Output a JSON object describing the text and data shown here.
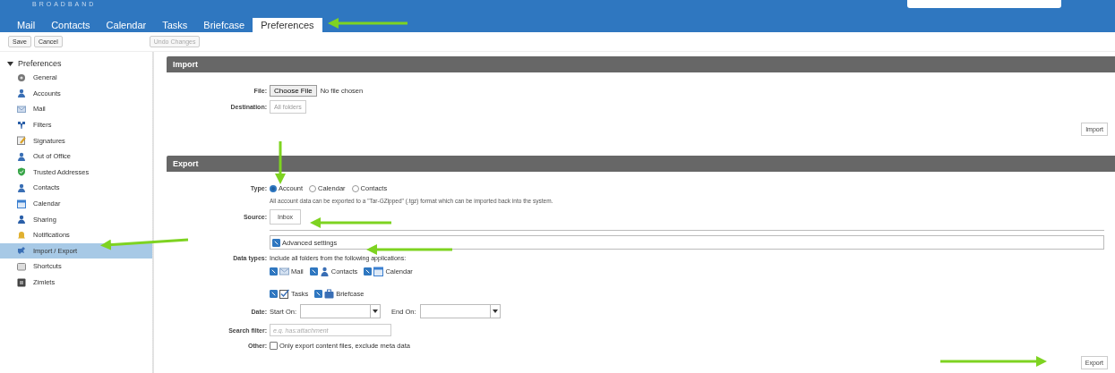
{
  "header": {
    "brand": "BROADBAND",
    "tabs": [
      {
        "label": "Mail",
        "selected": false
      },
      {
        "label": "Contacts",
        "selected": false
      },
      {
        "label": "Calendar",
        "selected": false
      },
      {
        "label": "Tasks",
        "selected": false
      },
      {
        "label": "Briefcase",
        "selected": false
      },
      {
        "label": "Preferences",
        "selected": true
      }
    ]
  },
  "toolbar": {
    "buttons": [
      {
        "label": "Save",
        "disabled": false
      },
      {
        "label": "Cancel",
        "disabled": false
      }
    ],
    "undo": {
      "label": "Undo Changes",
      "disabled": true
    }
  },
  "sidebar": {
    "label": "Preferences",
    "expanded": true,
    "children": [
      {
        "label": "General",
        "selected": false
      },
      {
        "label": "Accounts",
        "selected": false
      },
      {
        "label": "Mail",
        "selected": false
      },
      {
        "label": "Filters",
        "selected": false
      },
      {
        "label": "Signatures",
        "selected": false
      },
      {
        "label": "Out of Office",
        "selected": false
      },
      {
        "label": "Trusted Addresses",
        "selected": false
      },
      {
        "label": "Contacts",
        "selected": false
      },
      {
        "label": "Calendar",
        "selected": false
      },
      {
        "label": "Sharing",
        "selected": false
      },
      {
        "label": "Notifications",
        "selected": false
      },
      {
        "label": "Import / Export",
        "selected": true
      },
      {
        "label": "Shortcuts",
        "selected": false
      },
      {
        "label": "Zimlets",
        "selected": false
      }
    ]
  },
  "import": {
    "title": "Import",
    "file_label": "File:",
    "choose_button": "Choose File",
    "file_status": "No file chosen",
    "destination_label": "Destination:",
    "destination_button": "All folders",
    "button": "Import"
  },
  "export": {
    "title": "Export",
    "type_label": "Type:",
    "types": [
      {
        "label": "Account",
        "selected": true
      },
      {
        "label": "Calendar",
        "selected": false
      },
      {
        "label": "Contacts",
        "selected": false
      }
    ],
    "description": "All account data can be exported to a \"Tar-GZipped\" (.tgz) format which can be imported back into the system.",
    "source_label": "Source:",
    "source_button": "Inbox",
    "advanced": {
      "label": "Advanced settings",
      "checked": true
    },
    "data_types_label": "Data types:",
    "data_types_intro": "Include all folders from the following applications:",
    "apps": [
      {
        "label": "Mail",
        "checked": true
      },
      {
        "label": "Contacts",
        "checked": true
      },
      {
        "label": "Calendar",
        "checked": true
      },
      {
        "label": "Tasks",
        "checked": true
      },
      {
        "label": "Briefcase",
        "checked": true
      }
    ],
    "date_label": "Date:",
    "start_label": "Start On:",
    "end_label": "End On:",
    "search_label": "Search filter:",
    "search_placeholder": "e.g. has:attachment",
    "other_label": "Other:",
    "other": {
      "label": "Only export content files, exclude meta data",
      "checked": false
    },
    "button": "Export"
  }
}
